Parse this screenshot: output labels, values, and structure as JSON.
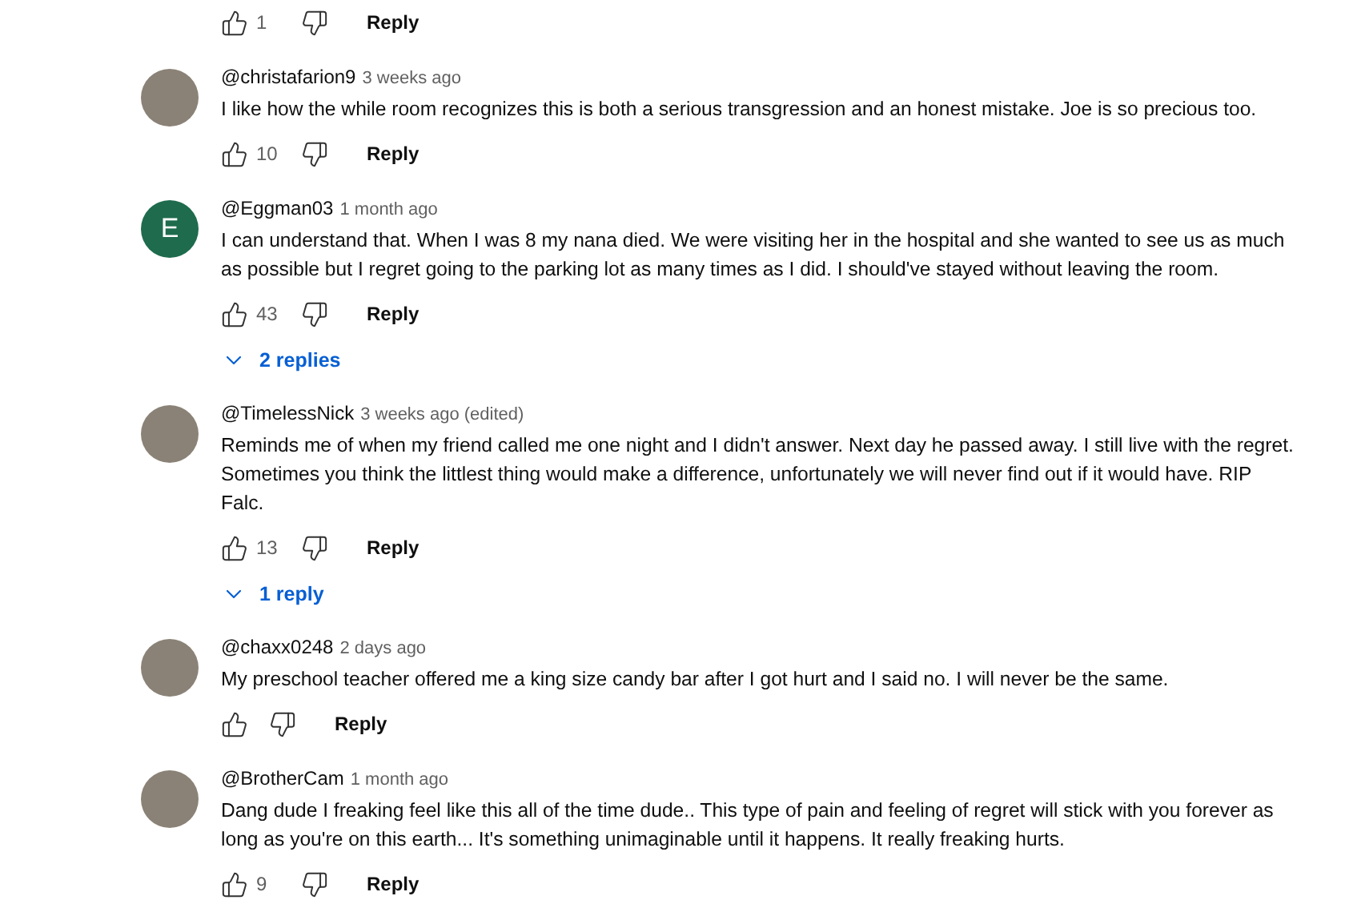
{
  "top_actions": {
    "likes": "1",
    "reply": "Reply"
  },
  "comments": [
    {
      "author": "@christafarion9",
      "time": "3 weeks ago",
      "avatar": {
        "kind": "photo"
      },
      "text": "I like how the while room recognizes this is both a serious transgression and an honest mistake. Joe is so precious too.",
      "likes": "10",
      "reply": "Reply"
    },
    {
      "author": "@Eggman03",
      "time": "1 month ago",
      "avatar": {
        "kind": "letter",
        "letter": "E",
        "color": "#1e6b4d"
      },
      "text": "I can understand that. When I was 8 my nana died. We were visiting her in the hospital and she wanted to see us as much as possible but I regret going to the parking lot as many times as I did. I should've stayed without leaving the room.",
      "likes": "43",
      "reply": "Reply",
      "replies": "2 replies"
    },
    {
      "author": "@TimelessNick",
      "time": "3 weeks ago (edited)",
      "avatar": {
        "kind": "photo"
      },
      "text": "Reminds me of when my friend called me one night and I didn't answer. Next day he passed away. I still live with the regret. Sometimes you think the littlest thing would make a difference, unfortunately we will never find out if it would have. RIP Falc.",
      "likes": "13",
      "reply": "Reply",
      "replies": "1 reply"
    },
    {
      "author": "@chaxx0248",
      "time": "2 days ago",
      "avatar": {
        "kind": "photo"
      },
      "text": "My preschool teacher offered me a king size candy bar after I got hurt and I said no. I will never be the same.",
      "reply": "Reply"
    },
    {
      "author": "@BrotherCam",
      "time": "1 month ago",
      "avatar": {
        "kind": "photo"
      },
      "text": "Dang dude I freaking feel like this all of the time dude.. This type of pain and feeling of regret will stick with you forever as long as you're on this earth... It's something unimaginable until it happens. It really freaking hurts.",
      "likes": "9",
      "reply": "Reply"
    }
  ]
}
